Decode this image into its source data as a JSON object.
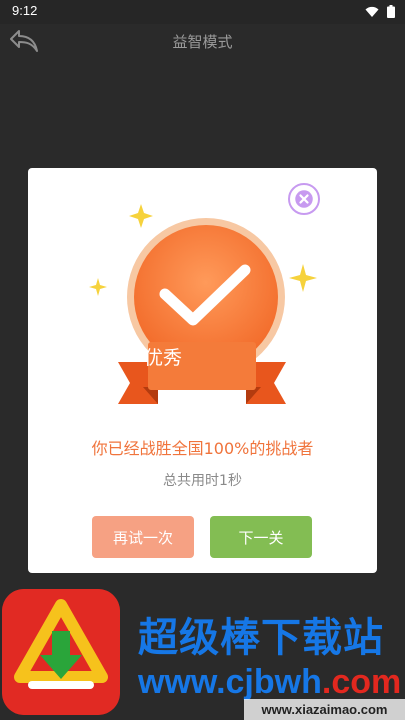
{
  "status_bar": {
    "time": "9:12"
  },
  "app_bar": {
    "title": "益智模式",
    "back_icon": "back-arrow-icon"
  },
  "result_dialog": {
    "badge_label": "优秀",
    "message": "你已经战胜全国100%的挑战者",
    "time_used": "总共用时1秒",
    "retry_label": "再试一次",
    "next_label": "下一关",
    "close_icon": "close-icon",
    "colors": {
      "accent": "#f0743c",
      "retry": "#f6a183",
      "next": "#83bd53",
      "star": "#f6d23c"
    }
  },
  "promo": {
    "name": "超级棒下载站",
    "domain": "www.cjbwh",
    "domain_suffix": ".com"
  },
  "watermark": {
    "text": "www.xiazaimao.com"
  }
}
